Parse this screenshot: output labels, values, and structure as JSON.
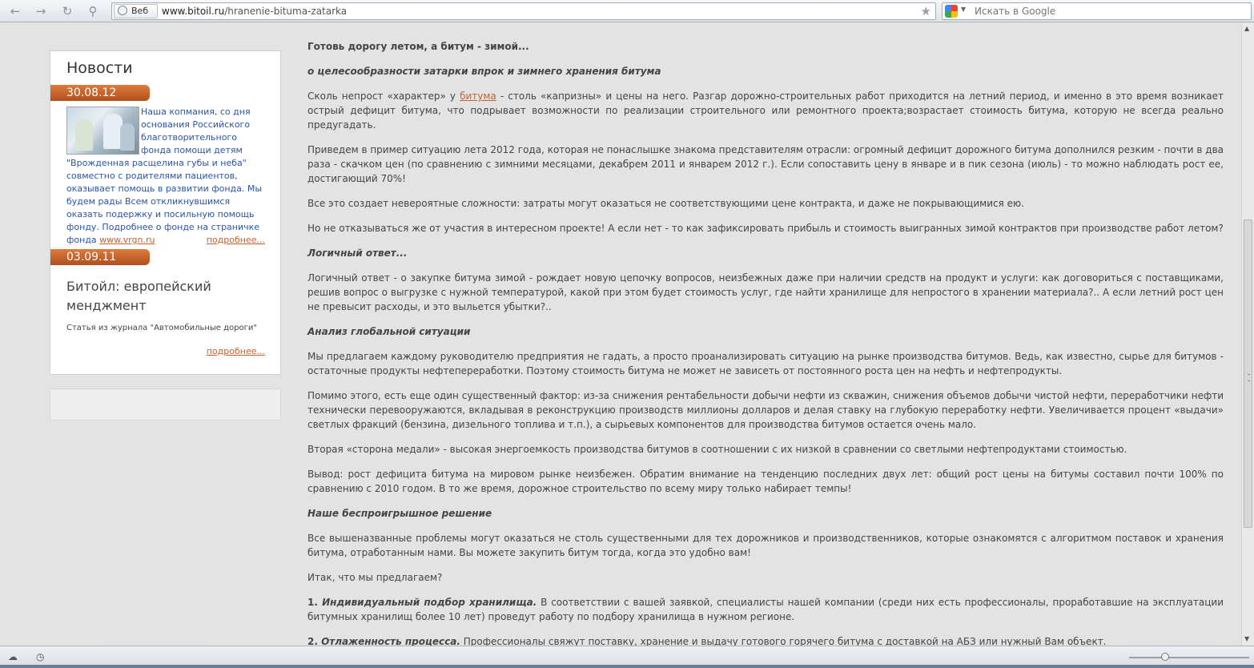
{
  "browser": {
    "engine_label": "Веб",
    "url_domain": "www.bitoil.ru",
    "url_path": "/hranenie-bituma-zatarka",
    "search_placeholder": "Искать в Google"
  },
  "sidebar": {
    "news_heading": "Новости",
    "items": [
      {
        "date": "30.08.12",
        "text": "Наша копмания, со дня основания Российского благотворительного фонда помощи детям \"Врожденная расщелина губы и неба\" совместно с родителями пациентов, оказывает помощь в развитии фонда. Мы будем рады Всем откликнувшимся оказать подержку и посильную помощь фонду. Подробнее о фонде на страничке фонда ",
        "link": "www.vrgn.ru",
        "more": "подробнее..."
      },
      {
        "date": "03.09.11",
        "title": "Битойл: европейский менджмент",
        "text": "Статья из журнала \"Автомобильные дороги\"",
        "more": "подробнее..."
      }
    ]
  },
  "article": {
    "title": "Готовь дорогу летом, а битум - зимой...",
    "subtitle": "о целесообразности затарки впрок и зимнего хранения битума",
    "p1_before": "Сколь непрост «характер» у ",
    "p1_link": "битума",
    "p1_after": " - столь «капризны» и цены на него. Разгар дорожно-строительных работ приходится на летний период, и именно в это время возникает острый дефицит битума, что подрывает возможности по реализации строительного или ремонтного  проекта;возрастает стоимость битума, которую не всегда реально предугадать.",
    "p2": "Приведем в пример ситуацию лета 2012 года, которая не понаслышке знакома представителям отрасли: огромный дефицит дорожного битума  дополнился резким - почти в два раза - скачком цен (по сравнению с зимними месяцами, декабрем 2011 и январем 2012 г.). Если сопоставить цену в январе и в пик сезона (июль) - то можно наблюдать рост ее, достигающий 70%!",
    "p3": "Все это создает невероятные сложности: затраты могут оказаться не соответствующими цене контракта, и даже не покрывающимися ею.",
    "p4": "Но не отказываться же от участия в интересном проекте! А если нет - то как зафиксировать прибыль и стоимость выигранных зимой контрактов при производстве работ летом?",
    "h1": "Логичный ответ...",
    "p5": "Логичный ответ - о закупке битума зимой - рождает новую цепочку вопросов, неизбежных даже при наличии средств на продукт и услуги: как договориться с поставщиками, решив вопрос о выгрузке с нужной температурой, какой при этом будет стоимость услуг, где найти хранилище для непростого в хранении материала?.. А если летний рост цен не превысит расходы, и это выльется убытки?..",
    "h2": "Анализ глобальной ситуации",
    "p6": "Мы предлагаем каждому руководителю предприятия не гадать, а просто проанализировать ситуацию на рынке производства битумов. Ведь, как известно, сырье для битумов - остаточные продукты нефтепереработки. Поэтому стоимость битума не может не зависеть от постоянного роста цен на нефть и нефтепродукты.",
    "p7": "Помимо этого, есть еще один существенный фактор: из-за снижения рентабельности добычи нефти из скважин, снижения объемов добычи чистой нефти, переработчики нефти технически перевооружаются, вкладывая в реконструкцию производств миллионы долларов и делая ставку на глубокую переработку нефти. Увеличивается процент «выдачи» светлых фракций (бензина, дизельного топлива и т.п.), а сырьевых компонентов для производства битумов остается очень мало.",
    "p8": "Вторая «сторона медали» - высокая энергоемкость производства битумов в соотношении с их низкой в сравнении со светлыми нефтепродуктами стоимостью.",
    "p9": "Вывод: рост дефицита битума на мировом рынке неизбежен. Обратим внимание на тенденцию последних двух лет: общий рост цены на битумы составил почти 100% по сравнению с 2010 годом. В то же время, дорожное строительство по всему миру только набирает темпы!",
    "h3": "Наше беспроигрышное решение",
    "p10": "Все вышеназванные проблемы могут оказаться не столь существенными для тех дорожников и производственников, которые ознакомятся с алгоритмом поставок и хранения битума, отработанным нами. Вы можете закупить битум тогда, когда это удобно вам!",
    "p11": "Итак, что мы предлагаем?",
    "l1_num": "1. ",
    "l1_title": "Индивидуальный подбор хранилища.",
    "l1_text": " В соответствии с вашей заявкой, специалисты нашей компании (среди них есть профессионалы, проработавшие на эксплуатации битумных хранилищ более 10 лет) проведут работу по подбору хранилища в нужном регионе.",
    "l2_num": "2. ",
    "l2_title": "Отлаженность процесса.",
    "l2_text": " Профессионалы свяжут поставку, хранение и выдачу готового горячего битума с доставкой на АБЗ  или нужный Вам объект."
  }
}
